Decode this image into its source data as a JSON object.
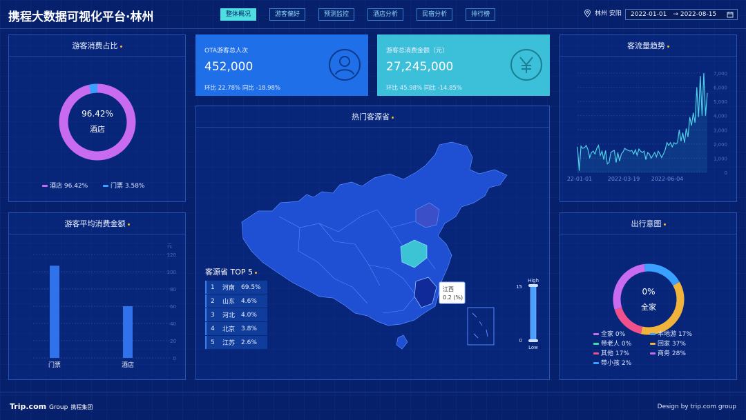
{
  "header": {
    "title": "携程大数据可视化平台·林州",
    "tabs": [
      "整体概况",
      "游客偏好",
      "预测监控",
      "酒店分析",
      "民宿分析",
      "排行榜"
    ],
    "active_tab": 0,
    "location": "林州 安阳",
    "date_start": "2022-01-01",
    "date_end": "2022-08-15",
    "date_arrow": "→"
  },
  "consumption_share": {
    "title": "游客消费占比",
    "center_value": "96.42%",
    "center_label": "酒店",
    "legend": [
      {
        "name": "酒店",
        "value": "96.42%",
        "color": "#c86bf0"
      },
      {
        "name": "门票",
        "value": "3.58%",
        "color": "#3aa0ff"
      }
    ]
  },
  "avg_spend": {
    "title": "游客平均消费金额",
    "unit": "元",
    "ticks": [
      "120",
      "100",
      "80",
      "60",
      "40",
      "20",
      "0"
    ],
    "chart_data": {
      "type": "bar",
      "categories": [
        "门票",
        "酒店"
      ],
      "values": [
        107,
        60
      ],
      "ylabel": "元",
      "ylim": [
        0,
        120
      ]
    }
  },
  "ota_card": {
    "label": "OTA游客总人次",
    "value": "452,000",
    "sub": "环比 22.78% 同比 -18.98%",
    "icon": "user-icon",
    "color": "#1f6fe8"
  },
  "spend_card": {
    "label": "游客总消费金额（元）",
    "value": "27,245,000",
    "sub": "环比 45.98% 同比 -14.85%",
    "icon": "yen-icon",
    "color": "#3cc0da"
  },
  "map": {
    "title": "热门客源省",
    "top5_title": "客源省 TOP 5",
    "top5": [
      {
        "rank": "1",
        "name": "河南",
        "value": "69.5%"
      },
      {
        "rank": "2",
        "name": "山东",
        "value": "4.6%"
      },
      {
        "rank": "3",
        "name": "河北",
        "value": "4.0%"
      },
      {
        "rank": "4",
        "name": "北京",
        "value": "3.8%"
      },
      {
        "rank": "5",
        "name": "江苏",
        "value": "2.6%"
      }
    ],
    "tooltip_name": "江西",
    "tooltip_value": "0.2 (%)",
    "scale_high": "High",
    "scale_max": "15",
    "scale_min": "0",
    "scale_low": "Low"
  },
  "traffic_trend": {
    "title": "客流量趋势",
    "ticks": [
      "7,000",
      "6,000",
      "5,000",
      "4,000",
      "3,000",
      "2,000",
      "1,000",
      "0"
    ],
    "x_labels": [
      "22-01-01",
      "2022-03-19",
      "2022-06-04"
    ],
    "chart_data": {
      "type": "line",
      "x": [
        "2022-01-01",
        "2022-03-19",
        "2022-06-04",
        "2022-08-15"
      ],
      "ylim": [
        0,
        7000
      ],
      "series": [
        {
          "values": [
            1800,
            120,
            1850,
            1700,
            1750,
            1900,
            1600,
            1050,
            1400,
            1500,
            1300,
            1700,
            1900,
            1200,
            1500,
            900,
            1550,
            600,
            700,
            1400,
            1500,
            1550,
            700,
            1400,
            800,
            1300,
            1450,
            1700,
            1600,
            1550,
            1500,
            1550,
            1300,
            1600,
            1200,
            1650,
            1500,
            1400,
            1500,
            900,
            1400,
            1300,
            1000,
            1200,
            1400,
            1100,
            1500,
            1300,
            1050,
            1300,
            1600,
            2100,
            1900,
            2100,
            1800,
            2100,
            2000,
            2100,
            3000,
            2200,
            2800,
            2100,
            3100,
            2500,
            3900,
            3300,
            4200,
            3500,
            6000,
            3900,
            6800,
            4000,
            7000,
            4000,
            5600
          ]
        }
      ]
    }
  },
  "travel_intent": {
    "title": "出行意图",
    "center_value": "0%",
    "center_label": "全家",
    "segments": [
      {
        "name": "全家",
        "value": "0%",
        "pct": 0,
        "color": "#c86bf0"
      },
      {
        "name": "本地游",
        "value": "17%",
        "pct": 17,
        "color": "#3aa0ff"
      },
      {
        "name": "带老人",
        "value": "0%",
        "pct": 0,
        "color": "#3ee0a0"
      },
      {
        "name": "回家",
        "value": "37%",
        "pct": 37,
        "color": "#f0b43c"
      },
      {
        "name": "其他",
        "value": "17%",
        "pct": 17,
        "color": "#f0508c"
      },
      {
        "name": "商务",
        "value": "28%",
        "pct": 28,
        "color": "#c86bf0"
      },
      {
        "name": "带小孩",
        "value": "2%",
        "pct": 2,
        "color": "#3aa0ff"
      }
    ]
  },
  "footer": {
    "brand": "Trip.com",
    "brand_group": "Group",
    "brand_cn": "携程集团",
    "credit": "Design by trip.com group"
  }
}
